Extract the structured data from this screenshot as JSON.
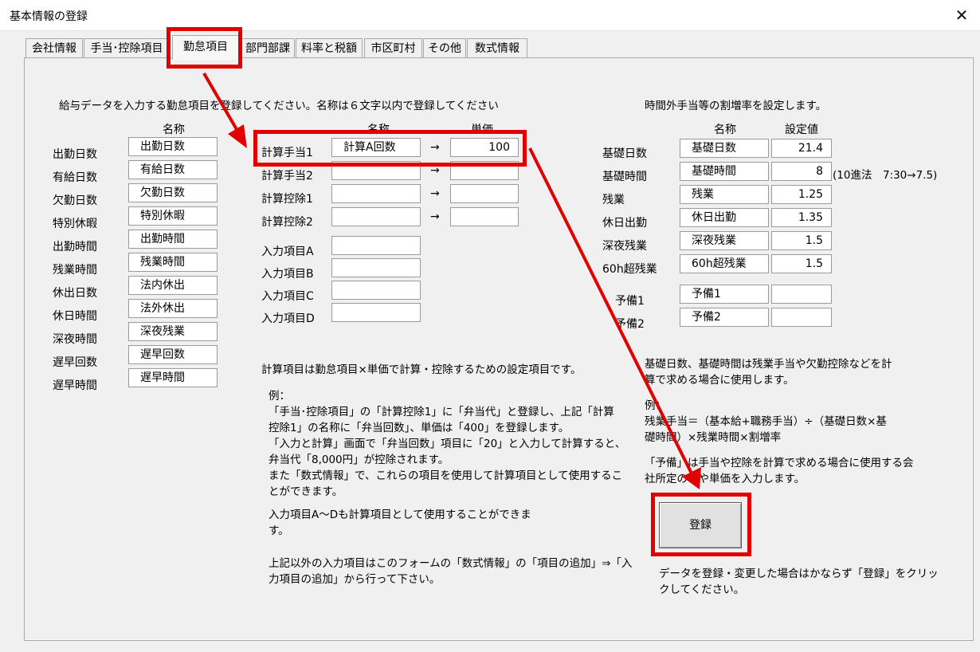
{
  "window": {
    "title": "基本情報の登録",
    "close_glyph": "✕"
  },
  "tabs": [
    "会社情報",
    "手当･控除項目",
    "勤怠項目",
    "部門部課",
    "料率と税額",
    "市区町村",
    "その他",
    "数式情報"
  ],
  "left": {
    "intro": "給与データを入力する勤怠項目を登録してください。名称は６文字以内で登録してください",
    "name_header": "名称",
    "rows": [
      {
        "label": "出勤日数",
        "value": "出勤日数"
      },
      {
        "label": "有給日数",
        "value": "有給日数"
      },
      {
        "label": "欠勤日数",
        "value": "欠勤日数"
      },
      {
        "label": "特別休暇",
        "value": "特別休暇"
      },
      {
        "label": "出勤時間",
        "value": "出勤時間"
      },
      {
        "label": "残業時間",
        "value": "残業時間"
      },
      {
        "label": "休出日数",
        "value": "法内休出"
      },
      {
        "label": "休日時間",
        "value": "法外休出"
      },
      {
        "label": "深夜時間",
        "value": "深夜残業"
      },
      {
        "label": "遅早回数",
        "value": "遅早回数"
      },
      {
        "label": "遅早時間",
        "value": "遅早時間"
      }
    ]
  },
  "middle": {
    "name_header": "名称",
    "price_header": "単価",
    "arrow": "→",
    "calc_rows": [
      {
        "label": "計算手当1",
        "name": "計算A回数",
        "price": "100"
      },
      {
        "label": "計算手当2",
        "name": "",
        "price": ""
      },
      {
        "label": "計算控除1",
        "name": "",
        "price": ""
      },
      {
        "label": "計算控除2",
        "name": "",
        "price": ""
      }
    ],
    "input_rows": [
      {
        "label": "入力項目A",
        "value": ""
      },
      {
        "label": "入力項目B",
        "value": ""
      },
      {
        "label": "入力項目C",
        "value": ""
      },
      {
        "label": "入力項目D",
        "value": ""
      }
    ],
    "note1": "計算項目は勤怠項目×単価で計算・控除するための設定項目です。",
    "example_lines": [
      "例：",
      "「手当･控除項目」の「計算控除1」に「弁当代」と登録し、上記「計算",
      "控除1」の名称に「弁当回数」、単価は「400」を登録します。",
      "「入力と計算」画面で「弁当回数」項目に「20」と入力して計算すると、",
      "弁当代「8,000円」が控除されます。",
      "また「数式情報」で、これらの項目を使用して計算項目として使用するこ",
      "とができます。"
    ],
    "note2_lines": [
      "入力項目A～Dも計算項目として使用することができま",
      "す。"
    ],
    "note3_lines": [
      "上記以外の入力項目はこのフォームの「数式情報」の「項目の追加」⇒「入",
      "力項目の追加」から行って下さい。"
    ]
  },
  "right": {
    "intro": "時間外手当等の割増率を設定します。",
    "name_header": "名称",
    "value_header": "設定値",
    "rows": [
      {
        "label": "基礎日数",
        "name": "基礎日数",
        "value": "21.4"
      },
      {
        "label": "基礎時間",
        "name": "基礎時間",
        "value": "8"
      },
      {
        "label": "残業",
        "name": "残業",
        "value": "1.25"
      },
      {
        "label": "休日出勤",
        "name": "休日出勤",
        "value": "1.35"
      },
      {
        "label": "深夜残業",
        "name": "深夜残業",
        "value": "1.5"
      },
      {
        "label": "60h超残業",
        "name": "60h超残業",
        "value": "1.5"
      }
    ],
    "hint": "(10進法　7:30→7.5)",
    "spare_rows": [
      {
        "label": "予備1",
        "name": "予備1",
        "value": ""
      },
      {
        "label": "予備2",
        "name": "予備2",
        "value": ""
      }
    ],
    "note1_lines": [
      "基礎日数、基礎時間は残業手当や欠勤控除などを計",
      "算で求める場合に使用します。"
    ],
    "example_lines": [
      "例：",
      "残業手当＝（基本給+職務手当）÷（基礎日数×基",
      "礎時間）×残業時間×割増率"
    ],
    "note2_lines": [
      "「予備」は手当や控除を計算で求める場合に使用する会",
      "社所定の率や単価を入力します。"
    ],
    "register_button": "登録",
    "footer_lines": [
      "データを登録・変更した場合はかならず「登録」をクリッ",
      "クしてください。"
    ]
  },
  "colors": {
    "highlight": "#e00000"
  }
}
